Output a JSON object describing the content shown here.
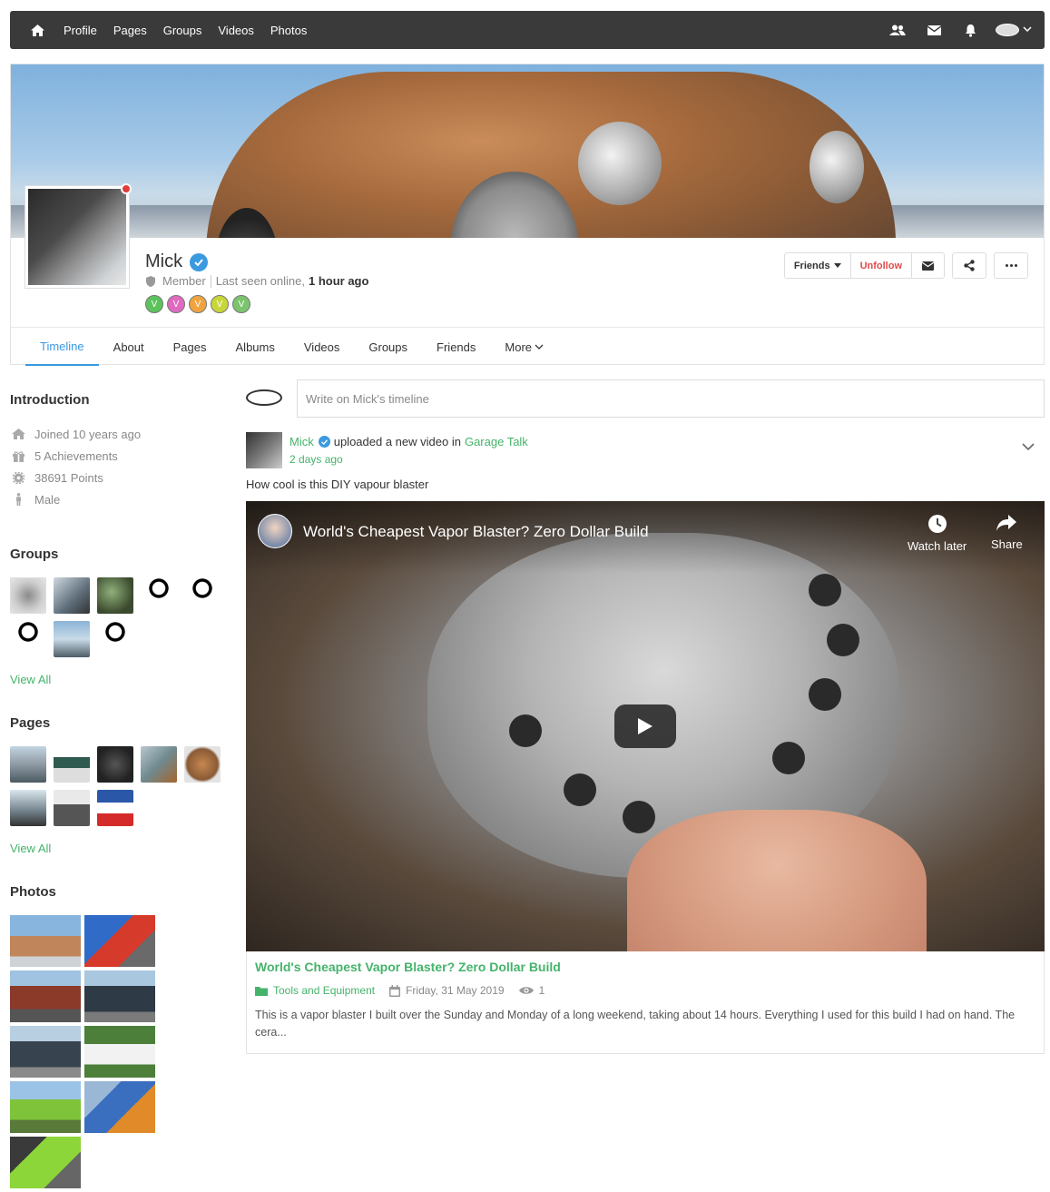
{
  "nav": {
    "links": [
      "Profile",
      "Pages",
      "Groups",
      "Videos",
      "Photos"
    ]
  },
  "profile": {
    "name": "Mick",
    "role": "Member",
    "last_seen_label": "Last seen online,",
    "last_seen_value": "1 hour ago",
    "badge_colors": [
      "#5cc35c",
      "#e06ac0",
      "#f0a440",
      "#c8d63a",
      "#7bc46d"
    ],
    "actions": {
      "friends": "Friends",
      "unfollow": "Unfollow"
    }
  },
  "tabs": [
    "Timeline",
    "About",
    "Pages",
    "Albums",
    "Videos",
    "Groups",
    "Friends",
    "More"
  ],
  "sidebar": {
    "intro_title": "Introduction",
    "intro": [
      {
        "icon": "home-icon",
        "text": "Joined 10 years ago"
      },
      {
        "icon": "gift-icon",
        "text": "5 Achievements"
      },
      {
        "icon": "gear-icon",
        "text": "38691 Points"
      },
      {
        "icon": "person-icon",
        "text": "Male"
      }
    ],
    "groups_title": "Groups",
    "groups_view_all": "View All",
    "pages_title": "Pages",
    "pages_view_all": "View All",
    "photos_title": "Photos"
  },
  "composer": {
    "placeholder": "Write on Mick's timeline"
  },
  "post": {
    "author": "Mick",
    "action": "uploaded a new video in",
    "group": "Garage Talk",
    "time": "2 days ago",
    "text": "How cool is this DIY vapour blaster",
    "video": {
      "title": "World's Cheapest Vapor Blaster? Zero Dollar Build",
      "watch_later": "Watch later",
      "share": "Share"
    },
    "info": {
      "title": "World's Cheapest Vapor Blaster? Zero Dollar Build",
      "category": "Tools and Equipment",
      "date": "Friday, 31 May 2019",
      "views": "1",
      "description": "This is a vapor blaster I built over the Sunday and Monday of a long weekend, taking about 14 hours. Everything I used for this build I had on hand. The cera..."
    }
  },
  "colors": {
    "accent_green": "#45b36b",
    "accent_blue": "#3b99e0",
    "unfollow_red": "#e24a4a",
    "navbar": "#3a3a3a"
  }
}
